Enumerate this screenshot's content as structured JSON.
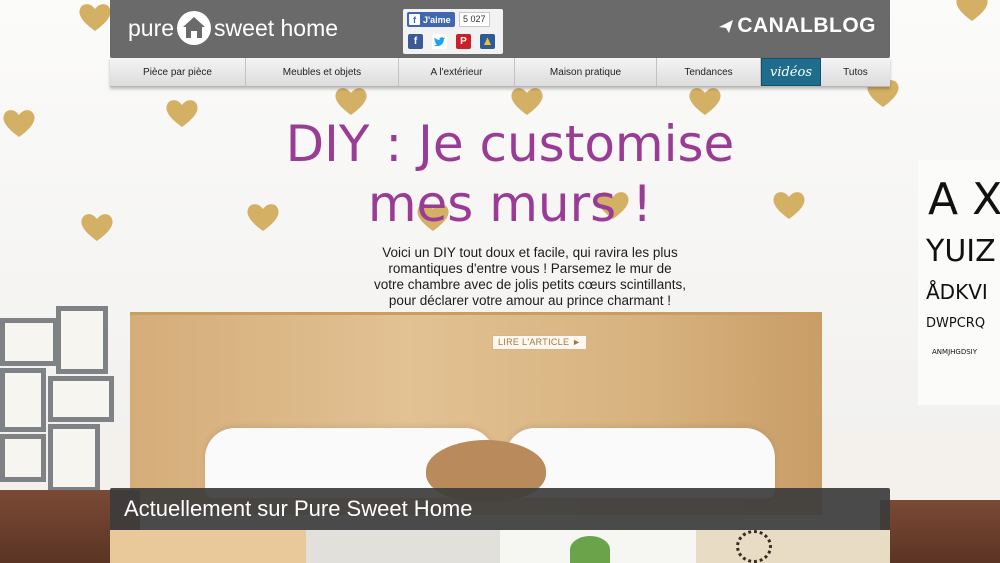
{
  "header": {
    "logo_left": "pure",
    "logo_right": "sweet home",
    "facebook": {
      "like_label": "J'aime",
      "like_count": "5 027"
    },
    "share_icons": [
      "facebook-icon",
      "twitter-icon",
      "pinterest-icon",
      "bookmark-icon"
    ],
    "canalblog_label": "CANALBLOG"
  },
  "nav": {
    "items": [
      {
        "label": "Pièce par pièce"
      },
      {
        "label": "Meubles et objets"
      },
      {
        "label": "A l'extérieur"
      },
      {
        "label": "Maison pratique"
      },
      {
        "label": "Tendances"
      },
      {
        "label": "vidéos"
      },
      {
        "label": "Tutos"
      }
    ]
  },
  "hero": {
    "title_line1": "DIY : Je customise",
    "title_line2": "mes murs !",
    "description_line1": "Voici un DIY tout doux et facile, qui ravira les plus",
    "description_line2": "romantiques d'entre vous ! Parsemez le mur de",
    "description_line3": "votre chambre avec de jolis petits cœurs scintillants,",
    "description_line4": "pour déclarer votre amour au prince charmant !",
    "read_more": "LIRE L'ARTICLE ►"
  },
  "eye_chart": {
    "row1": "A X",
    "row2": "YUIZ",
    "row3": "ÅDKVI",
    "row4": "DWPCRQ",
    "row5": "ANMJHGDSIY"
  },
  "current": {
    "label": "Actuellement sur Pure Sweet Home"
  },
  "colors": {
    "title": "#9a3c96",
    "topbar": "#6a6a6a",
    "video_tab": "#1f6d8c",
    "heart_gold": "#d4b064",
    "facebook": "#4267b2"
  }
}
